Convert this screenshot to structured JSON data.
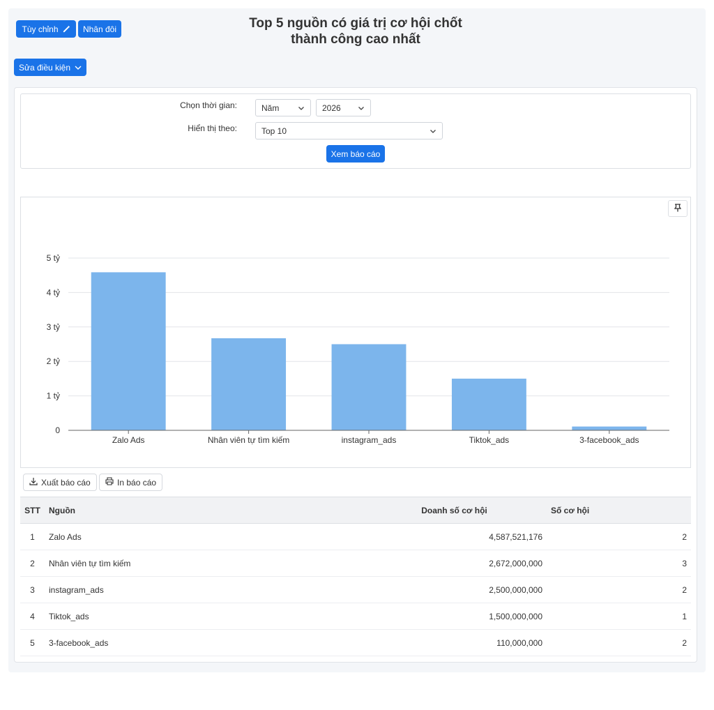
{
  "toolbar": {
    "customize_label": "Tùy chỉnh",
    "duplicate_label": "Nhân đôi",
    "edit_conditions_label": "Sửa điều kiện"
  },
  "page_title_line1": "Top 5 nguồn có giá trị cơ hội chốt",
  "page_title_line2": "thành công cao nhất",
  "filters": {
    "time_label": "Chọn thời gian:",
    "period_value": "Năm",
    "year_value": "2026",
    "display_label": "Hiển thị theo:",
    "display_value": "Top 10",
    "submit_label": "Xem báo cáo"
  },
  "actions": {
    "export_label": "Xuất báo cáo",
    "print_label": "In báo cáo"
  },
  "chart_data": {
    "type": "bar",
    "categories": [
      "Zalo Ads",
      "Nhân viên tự tìm kiếm",
      "instagram_ads",
      "Tiktok_ads",
      "3-facebook_ads"
    ],
    "values": [
      4587521176,
      2672000000,
      2500000000,
      1500000000,
      110000000
    ],
    "ylim": [
      0,
      5000000000
    ],
    "yticks": [
      0,
      1000000000,
      2000000000,
      3000000000,
      4000000000,
      5000000000
    ],
    "ytick_labels": [
      "0",
      "1 tỷ",
      "2 tỷ",
      "3 tỷ",
      "4 tỷ",
      "5 tỷ"
    ],
    "grid": true,
    "bar_color": "#7cb5ec"
  },
  "table": {
    "headers": [
      "STT",
      "Nguồn",
      "Doanh số cơ hội",
      "Số cơ hội"
    ],
    "rows": [
      {
        "stt": "1",
        "source": "Zalo Ads",
        "revenue": "4,587,521,176",
        "count": "2"
      },
      {
        "stt": "2",
        "source": "Nhân viên tự tìm kiếm",
        "revenue": "2,672,000,000",
        "count": "3"
      },
      {
        "stt": "3",
        "source": "instagram_ads",
        "revenue": "2,500,000,000",
        "count": "2"
      },
      {
        "stt": "4",
        "source": "Tiktok_ads",
        "revenue": "1,500,000,000",
        "count": "1"
      },
      {
        "stt": "5",
        "source": "3-facebook_ads",
        "revenue": "110,000,000",
        "count": "2"
      }
    ]
  },
  "colors": {
    "primary": "#1a73e8",
    "bar": "#7cb5ec"
  }
}
